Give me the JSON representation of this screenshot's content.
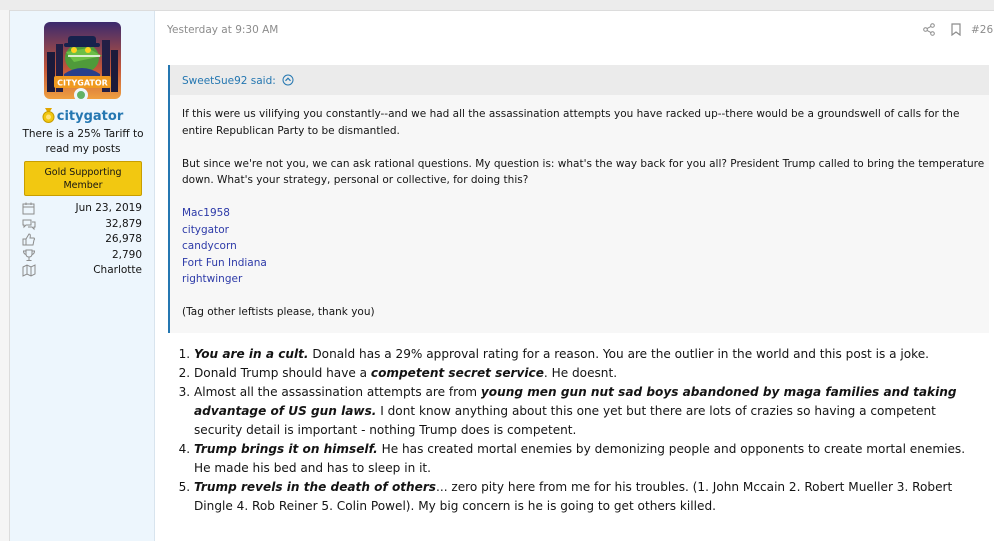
{
  "user": {
    "username": "citygator",
    "avatar_text": "CITYGATOR",
    "title": "There is a 25% Tariff to read my posts",
    "banner": "Gold Supporting Member",
    "stats": [
      {
        "icon": "calendar-icon",
        "value": "Jun 23, 2019"
      },
      {
        "icon": "messages-icon",
        "value": "32,879"
      },
      {
        "icon": "thumbs-up-icon",
        "value": "26,978"
      },
      {
        "icon": "trophy-icon",
        "value": "2,790"
      },
      {
        "icon": "map-icon",
        "value": "Charlotte"
      }
    ]
  },
  "post": {
    "date": "Yesterday at 9:30 AM",
    "number": "#26",
    "quote": {
      "author_line": "SweetSue92 said:",
      "p1": "If this were us vilifying you constantly--and we had all the assassination attempts you have racked up--there would be a groundswell of calls for the entire Republican Party to be dismantled.",
      "p2": "But since we're not you, we can ask rational questions. My question is: what's the way back for you all? President Trump called to bring the temperature down. What's your strategy, personal or collective, for doing this?",
      "mentions": [
        "Mac1958",
        "citygator",
        "candycorn",
        "Fort Fun Indiana",
        "rightwinger"
      ],
      "p3": "(Tag other leftists please, thank you)"
    },
    "list": [
      {
        "bold": "You are in a cult.",
        "rest": " Donald has a 29% approval rating for a reason. You are the outlier in the world and this post is a joke."
      },
      {
        "pre": "Donald Trump should have a ",
        "bold": "competent secret service",
        "rest": ". He doesnt."
      },
      {
        "pre": "Almost all the assassination attempts are from ",
        "bold": "young men gun nut sad boys abandoned by maga families and taking advantage of US gun laws.",
        "rest": " I dont know anything about this one yet but there are lots of crazies so having a competent security detail is important - nothing Trump does is competent."
      },
      {
        "bold": "Trump brings it on himself.",
        "rest": " He has created mortal enemies by demonizing people and opponents to create mortal enemies. He made his bed and has to sleep in it."
      },
      {
        "bold": "Trump revels in the death of others",
        "rest": "... zero pity here from me for his troubles. (1. John Mccain 2. Robert Mueller 3. Robert Dingle 4. Rob Reiner 5. Colin Powel). My big concern is he is going to get others killed."
      }
    ]
  },
  "colors": {
    "link": "#2577b1",
    "sidebar_bg": "#edf6fd",
    "banner_bg": "#f2c811",
    "mention": "#2d3aa8",
    "online": "#63b265"
  }
}
